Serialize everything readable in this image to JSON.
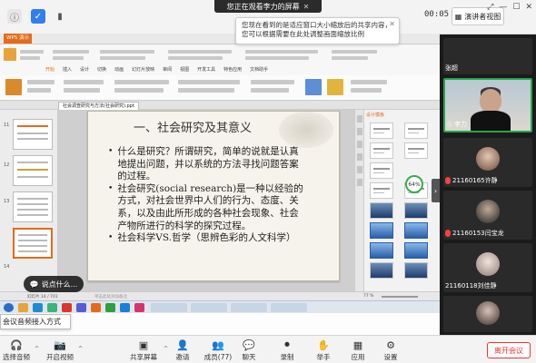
{
  "topbar": {
    "share_banner": "您正在观看李力的屏幕",
    "share_tip": "您现在看到的是适应窗口大小缩放后的共享内容，您可以根据需要在此处调整画面缩放比例",
    "timer": "00:05",
    "speaker_view_label": "演讲者视图"
  },
  "wps": {
    "app_tab": "WPS 演示",
    "ribbon_tabs": [
      "开始",
      "插入",
      "设计",
      "切换",
      "动画",
      "幻灯片放映",
      "审阅",
      "视图",
      "开发工具",
      "特色应用",
      "文档助手"
    ],
    "doc_tab": "社会调查研究与方法(社会研究).ppt",
    "status_left": "幻灯片 14 / 701",
    "notes_placeholder": "单击此处添加备注",
    "zoom": "77 %",
    "panel_title": "设计模板",
    "percent": "64%",
    "slide_numbers": [
      "11",
      "12",
      "13",
      "14"
    ]
  },
  "slide": {
    "title": "一、社会研究及其意义",
    "bullets": [
      "什么是研究？所谓研究，简单的说就是认真地提出问题，并以系统的方法寻找问题答案的过程。",
      "社会研究(social research)是一种以经验的方式，对社会世界中人们的行为、态度、关系，以及由此所形成的各种社会现象、社会产物所进行的科学的探究过程。",
      "社会科学VS.哲学（思辨色彩的人文科学）"
    ]
  },
  "chat_bubble": "说点什么...",
  "bottom_tip": "会议音频接入方式",
  "participants": [
    {
      "name": "张超"
    },
    {
      "name": "李力"
    },
    {
      "name": "21160165许静"
    },
    {
      "name": "21160153闫宝龙"
    },
    {
      "name": "21160118刘佳静"
    }
  ],
  "toolbar": {
    "audio": "选择音频",
    "video": "开启视频",
    "share": "共享屏幕",
    "invite": "邀请",
    "members": "成员(77)",
    "chat": "聊天",
    "record": "录制",
    "raise_hand": "举手",
    "apps": "应用",
    "settings": "设置",
    "leave": "离开会议"
  }
}
